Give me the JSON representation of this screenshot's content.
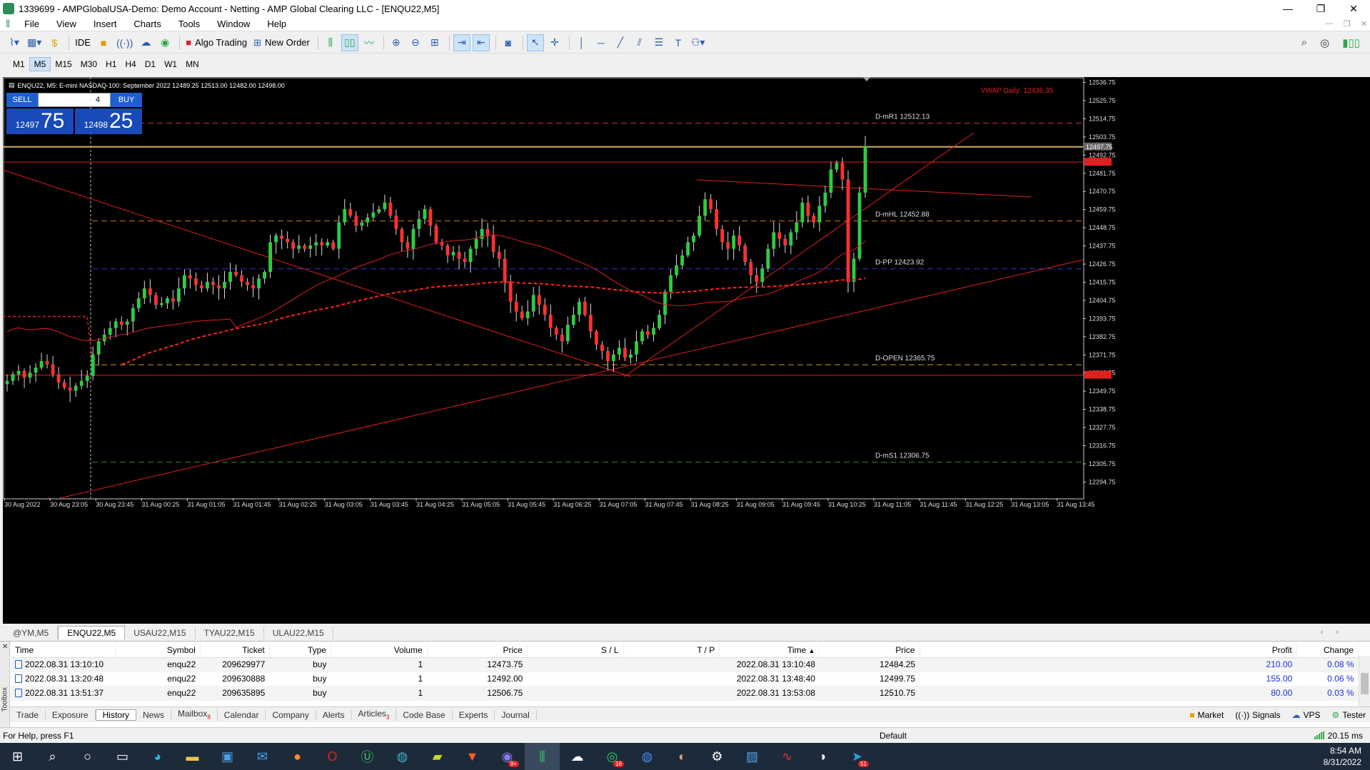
{
  "window": {
    "title": "1339699 - AMPGlobalUSA-Demo: Demo Account - Netting - AMP Global Clearing LLC - [ENQU22,M5]"
  },
  "menu": [
    "File",
    "View",
    "Insert",
    "Charts",
    "Tools",
    "Window",
    "Help"
  ],
  "toolbar": {
    "ide": "IDE",
    "algo_trading": "Algo Trading",
    "new_order": "New Order"
  },
  "timeframes": [
    "M1",
    "M5",
    "M15",
    "M30",
    "H1",
    "H4",
    "D1",
    "W1",
    "MN"
  ],
  "active_timeframe": "M5",
  "chart": {
    "info": "ENQU22, M5:  E-mini NASDAQ-100: September 2022   12489.25 12513.00 12482.00 12498.00",
    "vwap_label": "VWAP Daily: 12436.35",
    "oneclick": {
      "sell": "SELL",
      "buy": "BUY",
      "lot": "4",
      "sell_small": "12497",
      "sell_big": "75",
      "buy_small": "12498",
      "buy_big": "25"
    },
    "current_price_label": "12497.75"
  },
  "chart_data": {
    "type": "candlestick",
    "symbol": "ENQU22",
    "timeframe": "M5",
    "ylim": [
      12285,
      12540
    ],
    "y_ticks": [
      "12536.75",
      "12525.75",
      "12514.75",
      "12503.75",
      "12492.75",
      "12481.75",
      "12470.75",
      "12459.75",
      "12448.75",
      "12437.75",
      "12426.75",
      "12415.75",
      "12404.75",
      "12393.75",
      "12382.75",
      "12371.75",
      "12360.75",
      "12349.75",
      "12338.75",
      "12327.75",
      "12316.75",
      "12305.75",
      "12294.75"
    ],
    "x_ticks": [
      "30 Aug 2022",
      "30 Aug 23:05",
      "30 Aug 23:45",
      "31 Aug 00:25",
      "31 Aug 01:05",
      "31 Aug 01:45",
      "31 Aug 02:25",
      "31 Aug 03:05",
      "31 Aug 03:45",
      "31 Aug 04:25",
      "31 Aug 05:05",
      "31 Aug 05:45",
      "31 Aug 06:25",
      "31 Aug 07:05",
      "31 Aug 07:45",
      "31 Aug 08:25",
      "31 Aug 09:05",
      "31 Aug 09:45",
      "31 Aug 10:25",
      "31 Aug 11:05",
      "31 Aug 11:45",
      "31 Aug 12:25",
      "31 Aug 13:05",
      "31 Aug 13:45"
    ],
    "levels": [
      {
        "label": "D-mR1 12512.13",
        "value": 12512.13,
        "color": "#c83232",
        "style": "dashed"
      },
      {
        "label": "D-mHL 12452.88",
        "value": 12452.88,
        "color": "#c87820",
        "style": "dashed"
      },
      {
        "label": "D-PP 12423.92",
        "value": 12423.92,
        "color": "#3232c8",
        "style": "dashed"
      },
      {
        "label": "D-OPEN 12365.75",
        "value": 12365.75,
        "color": "#c8a020",
        "style": "dashed"
      },
      {
        "label": "D-mS1 12306.75",
        "value": 12306.75,
        "color": "#2a8a2a",
        "style": "dashed"
      }
    ],
    "bid_line": 12497.75,
    "close_candles": [
      12356,
      12360,
      12362,
      12358,
      12361,
      12364,
      12368,
      12366,
      12360,
      12355,
      12352,
      12350,
      12353,
      12356,
      12359,
      12372,
      12380,
      12384,
      12388,
      12392,
      12390,
      12392,
      12400,
      12406,
      12412,
      12408,
      12402,
      12403,
      12406,
      12404,
      12412,
      12420,
      12418,
      12414,
      12412,
      12416,
      12414,
      12412,
      12416,
      12422,
      12420,
      12416,
      12414,
      12412,
      12418,
      12422,
      12440,
      12444,
      12442,
      12440,
      12436,
      12438,
      12436,
      12438,
      12440,
      12438,
      12440,
      12436,
      12452,
      12460,
      12456,
      12450,
      12452,
      12455,
      12458,
      12460,
      12464,
      12456,
      12448,
      12440,
      12436,
      12448,
      12454,
      12460,
      12450,
      12440,
      12438,
      12432,
      12434,
      12430,
      12428,
      12436,
      12442,
      12448,
      12444,
      12434,
      12430,
      12416,
      12404,
      12398,
      12394,
      12398,
      12408,
      12402,
      12396,
      12388,
      12384,
      12380,
      12390,
      12396,
      12404,
      12396,
      12386,
      12378,
      12374,
      12368,
      12372,
      12376,
      12370,
      12372,
      12380,
      12386,
      12384,
      12388,
      12396,
      12410,
      12420,
      12426,
      12432,
      12440,
      12444,
      12456,
      12466,
      12460,
      12448,
      12440,
      12436,
      12444,
      12438,
      12428,
      12420,
      12416,
      12424,
      12436,
      12446,
      12442,
      12438,
      12446,
      12452,
      12464,
      12456,
      12452,
      12462,
      12470,
      12484,
      12488,
      12478,
      12416,
      12430,
      12470,
      12498
    ]
  },
  "symbol_tabs": [
    "@YM,M5",
    "ENQU22,M5",
    "USAU22,M15",
    "TYAU22,M15",
    "ULAU22,M15"
  ],
  "active_symbol_tab": "ENQU22,M5",
  "history": {
    "columns": [
      "Time",
      "Symbol",
      "Ticket",
      "Type",
      "Volume",
      "Price",
      "S / L",
      "T / P",
      "Time",
      "Price",
      "Profit",
      "Change"
    ],
    "rows": [
      {
        "time": "2022.08.31 13:10:10",
        "symbol": "enqu22",
        "ticket": "209629977",
        "type": "buy",
        "volume": "1",
        "price": "12473.75",
        "sl": "",
        "tp": "",
        "close_time": "2022.08.31 13:10:48",
        "close_price": "12484.25",
        "profit": "210.00",
        "change": "0.08 %"
      },
      {
        "time": "2022.08.31 13:20:48",
        "symbol": "enqu22",
        "ticket": "209630888",
        "type": "buy",
        "volume": "1",
        "price": "12492.00",
        "sl": "",
        "tp": "",
        "close_time": "2022.08.31 13:48:40",
        "close_price": "12499.75",
        "profit": "155.00",
        "change": "0.06 %"
      },
      {
        "time": "2022.08.31 13:51:37",
        "symbol": "enqu22",
        "ticket": "209635895",
        "type": "buy",
        "volume": "1",
        "price": "12506.75",
        "sl": "",
        "tp": "",
        "close_time": "2022.08.31 13:53:08",
        "close_price": "12510.75",
        "profit": "80.00",
        "change": "0.03 %"
      }
    ]
  },
  "toolbox_label": "Toolbox",
  "bottom_tabs": [
    "Trade",
    "Exposure",
    "History",
    "News",
    "Mailbox",
    "Calendar",
    "Company",
    "Alerts",
    "Articles",
    "Code Base",
    "Experts",
    "Journal"
  ],
  "bottom_tab_badges": {
    "Mailbox": "8",
    "Articles": "3"
  },
  "active_bottom_tab": "History",
  "bottom_right": [
    "Market",
    "Signals",
    "VPS",
    "Tester"
  ],
  "status": {
    "help": "For Help, press F1",
    "profile": "Default",
    "ping": "20.15 ms"
  },
  "taskbar": {
    "time": "8:54 AM",
    "date": "8/31/2022",
    "badges": {
      "chat": "16",
      "telegram": "51",
      "discord": "9+"
    }
  }
}
